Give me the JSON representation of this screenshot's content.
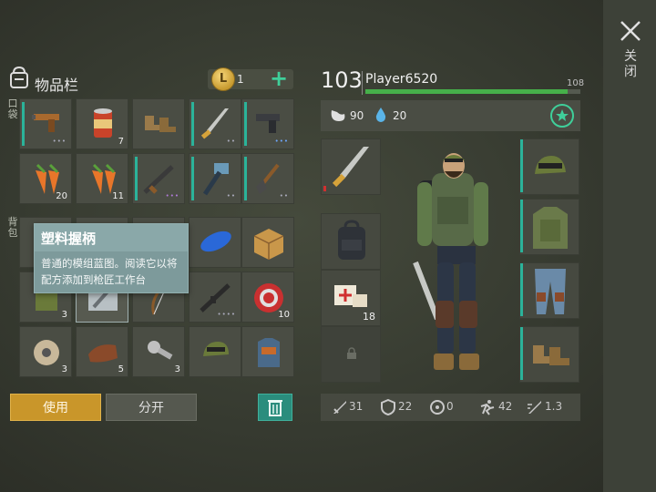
{
  "window": {
    "close_label": "关闭"
  },
  "inventory": {
    "title": "物品栏",
    "pockets_label": "口袋",
    "backpack_label": "背包",
    "coins": "1",
    "plus_label": "+",
    "slots": [
      {
        "name": "pistol-flare",
        "qty": "",
        "dots": "•••"
      },
      {
        "name": "canned-food",
        "qty": "7",
        "dots": ""
      },
      {
        "name": "boots",
        "qty": "",
        "dots": ""
      },
      {
        "name": "machete",
        "qty": "",
        "dots": "••"
      },
      {
        "name": "pistol",
        "qty": "",
        "dots": "•••"
      },
      {
        "name": "carrot",
        "qty": "20",
        "dots": ""
      },
      {
        "name": "carrot",
        "qty": "11",
        "dots": ""
      },
      {
        "name": "assault-rifle",
        "qty": "",
        "dots": "•••"
      },
      {
        "name": "hammer",
        "qty": "",
        "dots": "••"
      },
      {
        "name": "shovel",
        "qty": "",
        "dots": "••"
      },
      {
        "name": "knife",
        "qty": "",
        "dots": ""
      },
      {
        "name": "empty",
        "qty": "",
        "dots": ""
      },
      {
        "name": "empty",
        "qty": "",
        "dots": ""
      },
      {
        "name": "blue-tank",
        "qty": "",
        "dots": ""
      },
      {
        "name": "cardboard-box",
        "qty": "",
        "dots": ""
      },
      {
        "name": "camo-vest",
        "qty": "3",
        "dots": ""
      },
      {
        "name": "plastic-handle",
        "qty": "",
        "dots": ""
      },
      {
        "name": "bow",
        "qty": "",
        "dots": ""
      },
      {
        "name": "rifle",
        "qty": "",
        "dots": "••••"
      },
      {
        "name": "bottle-cap",
        "qty": "10",
        "dots": ""
      },
      {
        "name": "wire-spool",
        "qty": "3",
        "dots": ""
      },
      {
        "name": "leather",
        "qty": "5",
        "dots": ""
      },
      {
        "name": "bolts",
        "qty": "3",
        "dots": ""
      },
      {
        "name": "camo-cap",
        "qty": "",
        "dots": ""
      },
      {
        "name": "armor-vest",
        "qty": "",
        "dots": ""
      }
    ],
    "tooltip": {
      "title": "塑料握柄",
      "description": "普通的模组蓝图。阅读它以将配方添加到枪匠工作台"
    },
    "use_button": "使用",
    "split_button": "分开"
  },
  "player": {
    "level": "103",
    "name": "Player6520",
    "xp_max": "108",
    "xp_fraction": 0.94,
    "food": "90",
    "water": "20",
    "equipment": [
      {
        "name": "machete",
        "qty": ""
      },
      {
        "name": "backpack",
        "qty": ""
      },
      {
        "name": "bandage",
        "qty": "18"
      },
      {
        "name": "locked-slot",
        "qty": ""
      }
    ],
    "armor": [
      "camo-cap",
      "camo-armor",
      "camo-pants",
      "boots"
    ],
    "stats": {
      "attack": "31",
      "defense": "22",
      "radiation": "0",
      "speed": "42",
      "attack_speed": "1.3"
    }
  },
  "colors": {
    "accent": "#3fcf9a",
    "gold": "#c9962a",
    "trash": "#2a8d7d",
    "xp": "#46b04a",
    "tooltip": "#7d9a9b"
  }
}
